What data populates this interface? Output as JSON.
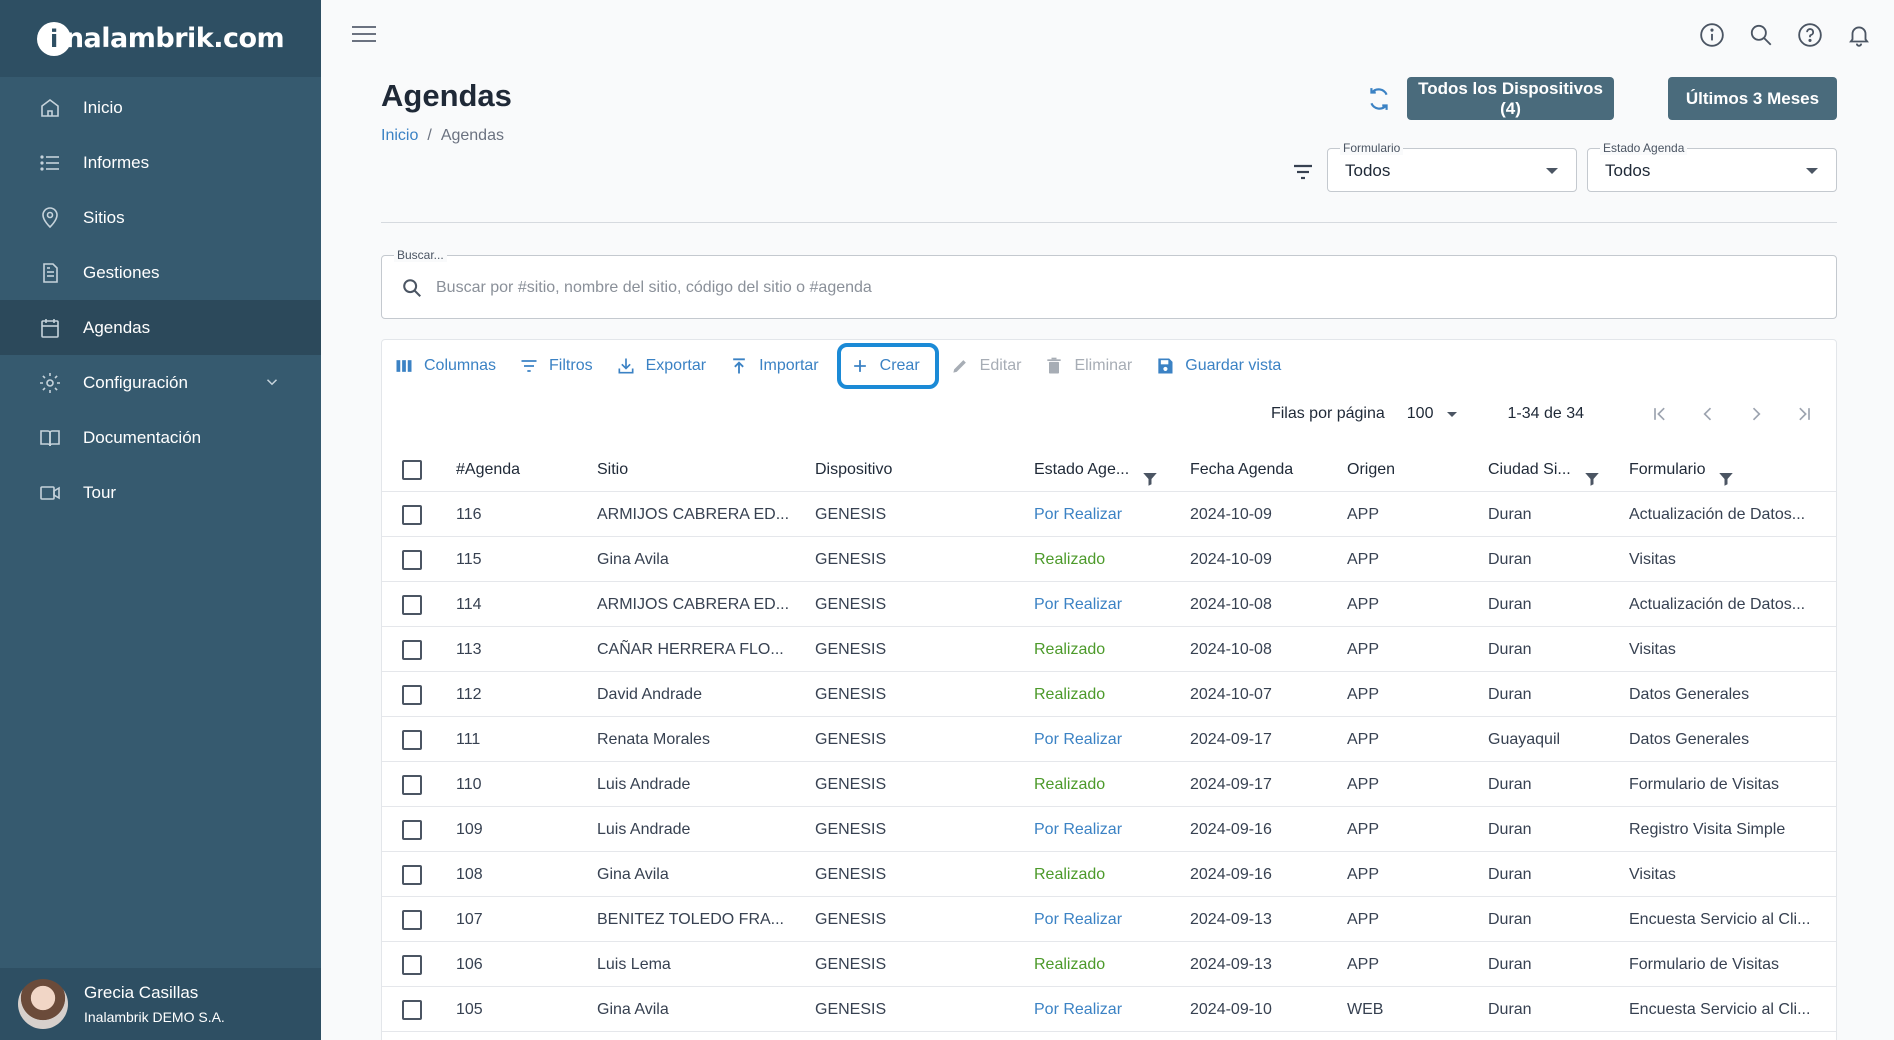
{
  "app": {
    "logo_text": "nalambrik.com",
    "logo_initial": "i"
  },
  "sidebar": {
    "items": [
      {
        "label": "Inicio",
        "icon": "home-icon"
      },
      {
        "label": "Informes",
        "icon": "list-icon"
      },
      {
        "label": "Sitios",
        "icon": "location-pin-icon"
      },
      {
        "label": "Gestiones",
        "icon": "document-icon"
      },
      {
        "label": "Agendas",
        "icon": "calendar-icon",
        "active": true
      },
      {
        "label": "Configuración",
        "icon": "gear-icon",
        "expandable": true
      },
      {
        "label": "Documentación",
        "icon": "book-icon"
      },
      {
        "label": "Tour",
        "icon": "video-icon"
      }
    ],
    "user": {
      "name": "Grecia Casillas",
      "org": "Inalambrik DEMO S.A."
    }
  },
  "header": {
    "title": "Agendas",
    "breadcrumb": {
      "home": "Inicio",
      "separator": "/",
      "current": "Agendas"
    },
    "devices_button": "Todos los Dispositivos (4)",
    "period_button": "Últimos 3 Meses",
    "formulario": {
      "label": "Formulario",
      "value": "Todos"
    },
    "estado": {
      "label": "Estado Agenda",
      "value": "Todos"
    }
  },
  "search": {
    "label": "Buscar...",
    "placeholder": "Buscar por #sitio, nombre del sitio, código del sitio o #agenda",
    "value": ""
  },
  "toolbar": {
    "columns": "Columnas",
    "filters": "Filtros",
    "export": "Exportar",
    "import": "Importar",
    "create": "Crear",
    "edit": "Editar",
    "delete": "Eliminar",
    "save_view": "Guardar vista"
  },
  "pager": {
    "rows_label": "Filas por página",
    "rows_value": "100",
    "range": "1-34 de 34"
  },
  "table": {
    "headers": {
      "agenda": "#Agenda",
      "sitio": "Sitio",
      "dispositivo": "Dispositivo",
      "estado": "Estado Age...",
      "fecha": "Fecha Agenda",
      "origen": "Origen",
      "ciudad": "Ciudad Si...",
      "formulario": "Formulario"
    },
    "rows": [
      {
        "agenda": "116",
        "sitio": "ARMIJOS CABRERA ED...",
        "dispositivo": "GENESIS",
        "estado": "Por Realizar",
        "fecha": "2024-10-09",
        "origen": "APP",
        "ciudad": "Duran",
        "formulario": "Actualización de Datos..."
      },
      {
        "agenda": "115",
        "sitio": "Gina Avila",
        "dispositivo": "GENESIS",
        "estado": "Realizado",
        "fecha": "2024-10-09",
        "origen": "APP",
        "ciudad": "Duran",
        "formulario": "Visitas"
      },
      {
        "agenda": "114",
        "sitio": "ARMIJOS CABRERA ED...",
        "dispositivo": "GENESIS",
        "estado": "Por Realizar",
        "fecha": "2024-10-08",
        "origen": "APP",
        "ciudad": "Duran",
        "formulario": "Actualización de Datos..."
      },
      {
        "agenda": "113",
        "sitio": "CAÑAR HERRERA FLO...",
        "dispositivo": "GENESIS",
        "estado": "Realizado",
        "fecha": "2024-10-08",
        "origen": "APP",
        "ciudad": "Duran",
        "formulario": "Visitas"
      },
      {
        "agenda": "112",
        "sitio": "David Andrade",
        "dispositivo": "GENESIS",
        "estado": "Realizado",
        "fecha": "2024-10-07",
        "origen": "APP",
        "ciudad": "Duran",
        "formulario": "Datos Generales"
      },
      {
        "agenda": "111",
        "sitio": "Renata Morales",
        "dispositivo": "GENESIS",
        "estado": "Por Realizar",
        "fecha": "2024-09-17",
        "origen": "APP",
        "ciudad": "Guayaquil",
        "formulario": "Datos Generales"
      },
      {
        "agenda": "110",
        "sitio": "Luis Andrade",
        "dispositivo": "GENESIS",
        "estado": "Realizado",
        "fecha": "2024-09-17",
        "origen": "APP",
        "ciudad": "Duran",
        "formulario": "Formulario de Visitas"
      },
      {
        "agenda": "109",
        "sitio": "Luis Andrade",
        "dispositivo": "GENESIS",
        "estado": "Por Realizar",
        "fecha": "2024-09-16",
        "origen": "APP",
        "ciudad": "Duran",
        "formulario": "Registro Visita Simple"
      },
      {
        "agenda": "108",
        "sitio": "Gina Avila",
        "dispositivo": "GENESIS",
        "estado": "Realizado",
        "fecha": "2024-09-16",
        "origen": "APP",
        "ciudad": "Duran",
        "formulario": "Visitas"
      },
      {
        "agenda": "107",
        "sitio": "BENITEZ TOLEDO FRA...",
        "dispositivo": "GENESIS",
        "estado": "Por Realizar",
        "fecha": "2024-09-13",
        "origen": "APP",
        "ciudad": "Duran",
        "formulario": "Encuesta Servicio al Cli..."
      },
      {
        "agenda": "106",
        "sitio": "Luis Lema",
        "dispositivo": "GENESIS",
        "estado": "Realizado",
        "fecha": "2024-09-13",
        "origen": "APP",
        "ciudad": "Duran",
        "formulario": "Formulario de Visitas"
      },
      {
        "agenda": "105",
        "sitio": "Gina Avila",
        "dispositivo": "GENESIS",
        "estado": "Por Realizar",
        "fecha": "2024-09-10",
        "origen": "WEB",
        "ciudad": "Duran",
        "formulario": "Encuesta Servicio al Cli..."
      }
    ]
  },
  "colors": {
    "sidebar": "#365a6f",
    "sidebar_dark": "#2e4f63",
    "accent": "#3b82c4",
    "por_realizar": "#3b82c4",
    "realizado": "#4c9a2a",
    "highlight_ring": "#1b8ad6"
  }
}
